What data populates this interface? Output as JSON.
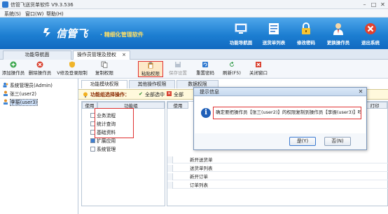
{
  "window": {
    "title": "信管飞送货单软件 V9.3.536",
    "controls": [
      "–",
      "□",
      "✕"
    ]
  },
  "menu": [
    "系统(S)",
    "窗口(W)",
    "帮助(H)"
  ],
  "banner": {
    "logo": "信管飞",
    "slogan": "· 精细化管理软件",
    "nav": [
      {
        "label": "功能导航面",
        "icon": "monitor-icon"
      },
      {
        "label": "送货单列表",
        "icon": "list-icon"
      },
      {
        "label": "修改密码",
        "icon": "lock-icon"
      },
      {
        "label": "更换操作员",
        "icon": "user-icon"
      },
      {
        "label": "退出系统",
        "icon": "exit-icon"
      }
    ]
  },
  "main_tabs": [
    {
      "label": "功能导航面"
    },
    {
      "label": "操作员管理及授权",
      "close": "×"
    }
  ],
  "toolbar": [
    {
      "label": "添加操作员"
    },
    {
      "label": "删除操作员"
    },
    {
      "label": "V修及登录限制"
    },
    {
      "label": "复制权限"
    },
    {
      "label": "粘贴权限"
    },
    {
      "label": "保存设置"
    },
    {
      "label": "重置密码"
    },
    {
      "label": "刷新(F5)"
    },
    {
      "label": "关闭窗口"
    }
  ],
  "operators": [
    {
      "label": "系统管理员(Admin)"
    },
    {
      "label": "张三(user2)"
    },
    {
      "label": "李振(user3)"
    }
  ],
  "sub_tabs": [
    "功能模块权限",
    "其他操作权限",
    "数据权限"
  ],
  "op_bar": {
    "title": "功能组选择操作：",
    "select_all": "全部选中",
    "select_all_2": "全部"
  },
  "func_grid": {
    "headers": [
      "使用",
      "功能组"
    ],
    "items": [
      {
        "label": "业务流程",
        "checked": false
      },
      {
        "label": "统计查询",
        "checked": false
      },
      {
        "label": "基础资料",
        "checked": false
      },
      {
        "label": "扩展应用",
        "checked": true
      },
      {
        "label": "系统管理",
        "checked": false
      }
    ]
  },
  "perm_grid": {
    "headers": [
      "使用",
      "打印"
    ],
    "rows": [
      "新开送货单",
      "送货单列表",
      "新开订单",
      "订单列表"
    ]
  },
  "dialog": {
    "title": "提示信息",
    "message": "确定要把操作员【张三(user2)】的权限复制到操作员【李振(user3)】吗?",
    "yes": "是(Y)",
    "no": "否(N)",
    "icon_glyph": "i"
  }
}
